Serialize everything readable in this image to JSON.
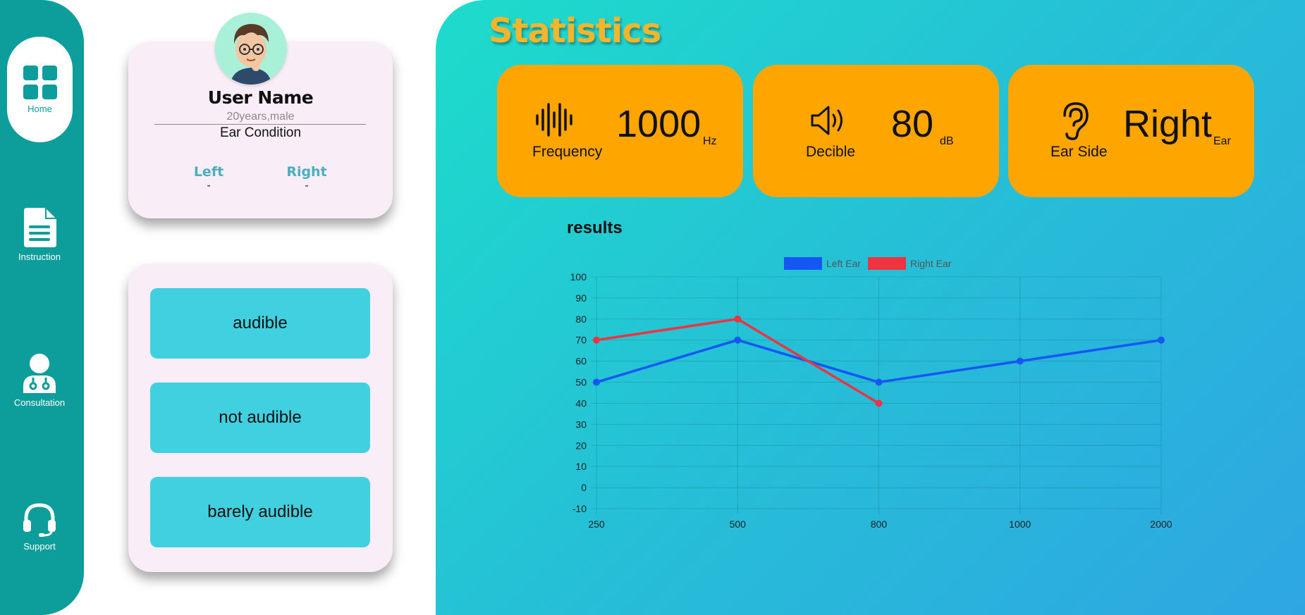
{
  "nav": {
    "home": "Home",
    "instruction": "Instruction",
    "consultation": "Consultation",
    "support": "Support"
  },
  "profile": {
    "name": "User Name",
    "meta": "20years,male",
    "ear_condition": "Ear Condition",
    "left_label": "Left",
    "left_value": "-",
    "right_label": "Right",
    "right_value": "-"
  },
  "responses": {
    "audible": "audible",
    "not_audible": "not audible",
    "barely_audible": "barely audible"
  },
  "stats": {
    "title": "Statistics",
    "frequency": {
      "label": "Frequency",
      "value": "1000",
      "unit": "Hz"
    },
    "decible": {
      "label": "Decible",
      "value": "80",
      "unit": "dB"
    },
    "ear_side": {
      "label": "Ear Side",
      "value": "Right",
      "unit": "Ear"
    }
  },
  "colors": {
    "sidebar": "#0d9d9b",
    "card_bg": "#f9eef7",
    "button_bg": "#41d0e0",
    "stat_card": "#ffa500",
    "title_gold": "#f3b52c",
    "left_series": "#1557f2",
    "right_series": "#f03340"
  },
  "chart_data": {
    "type": "line",
    "title": "results",
    "categories": [
      "250",
      "500",
      "800",
      "1000",
      "2000"
    ],
    "ylim": [
      -10,
      100
    ],
    "yticks": [
      100,
      90,
      80,
      70,
      60,
      50,
      40,
      30,
      20,
      10,
      0,
      -10
    ],
    "grid": true,
    "legend_position": "top",
    "series": [
      {
        "name": "Left Ear",
        "color": "#1557f2",
        "values": [
          50,
          70,
          50,
          60,
          70
        ]
      },
      {
        "name": "Right Ear",
        "color": "#f03340",
        "values": [
          70,
          80,
          40,
          null,
          null
        ]
      }
    ]
  }
}
